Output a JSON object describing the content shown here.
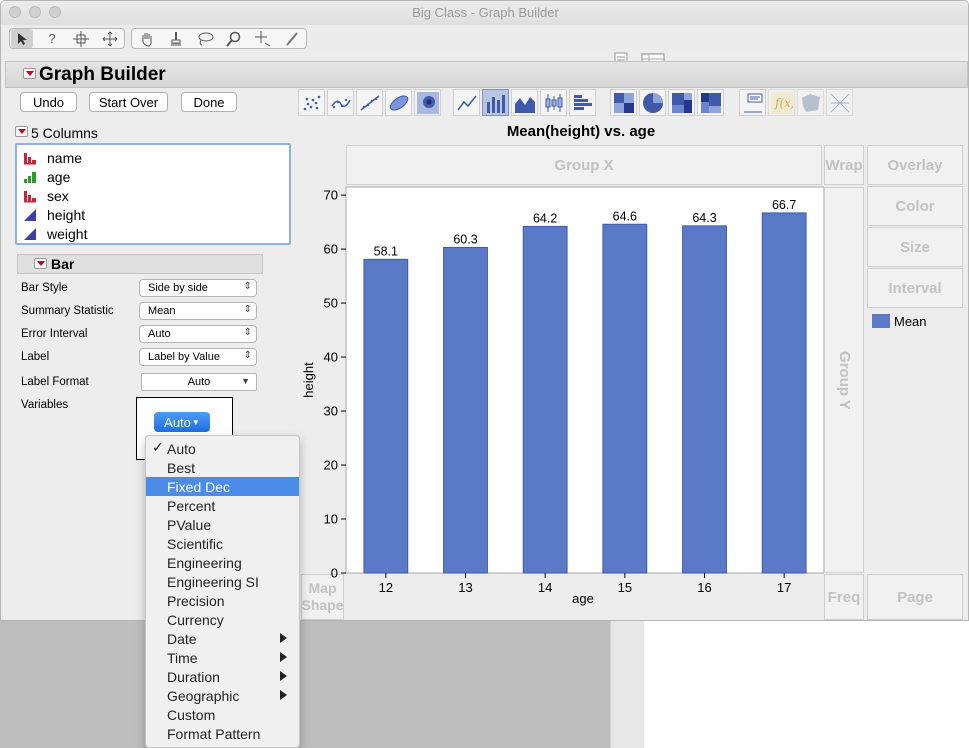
{
  "window": {
    "title": "Big Class - Graph Builder"
  },
  "graph_builder": {
    "title": "Graph Builder",
    "buttons": {
      "undo": "Undo",
      "start_over": "Start Over",
      "done": "Done"
    }
  },
  "columns": {
    "label": "5 Columns",
    "items": [
      {
        "name": "name",
        "type": "nominal"
      },
      {
        "name": "age",
        "type": "ordinal"
      },
      {
        "name": "sex",
        "type": "nominal"
      },
      {
        "name": "height",
        "type": "continuous"
      },
      {
        "name": "weight",
        "type": "continuous"
      }
    ]
  },
  "bar_panel": {
    "title": "Bar",
    "properties": [
      {
        "label": "Bar Style",
        "value": "Side by side"
      },
      {
        "label": "Summary Statistic",
        "value": "Mean"
      },
      {
        "label": "Error Interval",
        "value": "Auto"
      },
      {
        "label": "Label",
        "value": "Label by Value"
      }
    ],
    "label_format": {
      "label": "Label Format",
      "value": "Auto"
    },
    "variables": {
      "label": "Variables",
      "button": "Auto"
    }
  },
  "format_menu": {
    "items": [
      {
        "label": "Auto",
        "checked": true,
        "submenu": false
      },
      {
        "label": "Best",
        "submenu": false
      },
      {
        "label": "Fixed Dec",
        "highlighted": true,
        "submenu": false
      },
      {
        "label": "Percent",
        "submenu": false
      },
      {
        "label": "PValue",
        "submenu": false
      },
      {
        "label": "Scientific",
        "submenu": false
      },
      {
        "label": "Engineering",
        "submenu": false
      },
      {
        "label": "Engineering SI",
        "submenu": false
      },
      {
        "label": "Precision",
        "submenu": false
      },
      {
        "label": "Currency",
        "submenu": false
      },
      {
        "label": "Date",
        "submenu": true
      },
      {
        "label": "Time",
        "submenu": true
      },
      {
        "label": "Duration",
        "submenu": true
      },
      {
        "label": "Geographic",
        "submenu": true
      },
      {
        "label": "Custom",
        "submenu": false
      },
      {
        "label": "Format Pattern",
        "submenu": false
      }
    ],
    "check_glyph": "✓"
  },
  "drop_zones": {
    "group_x": "Group X",
    "group_y": "Group Y",
    "wrap": "Wrap",
    "overlay": "Overlay",
    "color": "Color",
    "size": "Size",
    "interval": "Interval",
    "freq": "Freq",
    "page": "Page",
    "map_shape_1": "Map",
    "map_shape_2": "Shape"
  },
  "legend": {
    "label": "Mean",
    "color": "#5a7ac8"
  },
  "chart_data": {
    "type": "bar",
    "title": "Mean(height) vs. age",
    "xlabel": "age",
    "ylabel": "height",
    "categories": [
      "12",
      "13",
      "14",
      "15",
      "16",
      "17"
    ],
    "values": [
      58.1,
      60.3,
      64.2,
      64.6,
      64.3,
      66.7
    ],
    "data_labels": [
      "58.1",
      "60.3",
      "64.2",
      "64.6",
      "64.3",
      "66.7"
    ],
    "ylim": [
      0,
      71.5
    ],
    "yticks": [
      0,
      10,
      20,
      30,
      40,
      50,
      60,
      70
    ],
    "bar_color": "#5a7ac8",
    "bar_border": "#3e5aa8",
    "grid": false
  }
}
